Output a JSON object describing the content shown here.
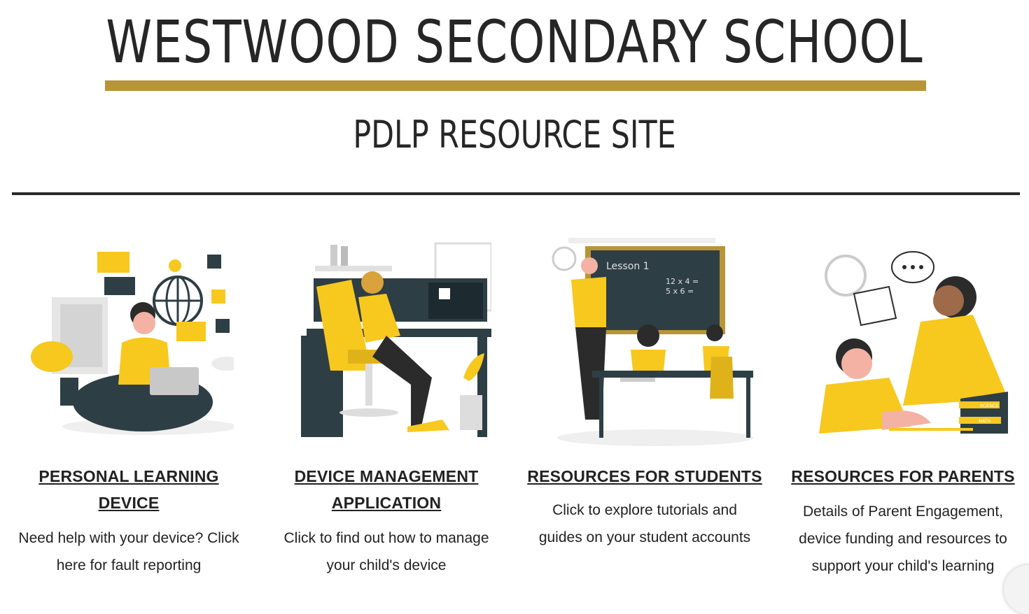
{
  "header": {
    "title": "WESTWOOD SECONDARY SCHOOL",
    "subtitle": "PDLP RESOURCE SITE"
  },
  "colors": {
    "gold": "#B79536",
    "yellow": "#F7C81E",
    "dark": "#2E3E45",
    "divider": "#2b2b2b"
  },
  "cards": [
    {
      "title": "PERSONAL LEARNING DEVICE",
      "description": "Need help with your device? Click here for fault reporting",
      "illustration": "woman-with-laptop-illustration"
    },
    {
      "title": "DEVICE MANAGEMENT APPLICATION",
      "description": "Click to find out how to manage your child's device",
      "illustration": "person-at-computer-desk-illustration"
    },
    {
      "title": "RESOURCES FOR STUDENTS",
      "description": "Click to explore tutorials and guides on your student accounts",
      "illustration": "classroom-teacher-illustration",
      "board_text": "Lesson 1",
      "board_math_1": "12 x 4 =",
      "board_math_2": "5 x 6 ="
    },
    {
      "title": "RESOURCES FOR PARENTS",
      "description": "Details of Parent Engagement, device funding and resources to support your child's learning",
      "illustration": "parent-helping-child-illustration",
      "book_label_1": "SCIENCE",
      "book_label_2": "MATH"
    }
  ]
}
